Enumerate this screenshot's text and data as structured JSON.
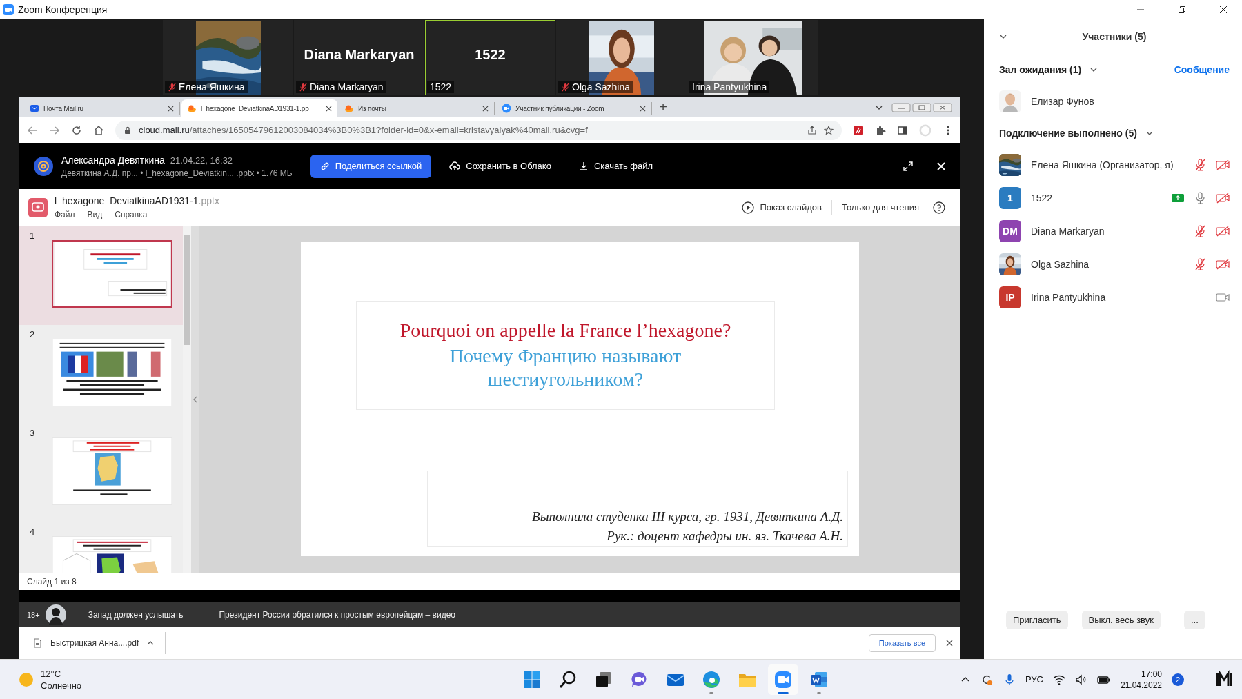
{
  "window": {
    "title": "Zoom Конференция"
  },
  "video_tiles": [
    {
      "name": "Елена Яшкина",
      "kind": "picture",
      "muted": true,
      "speaking": false
    },
    {
      "name": "Diana Markaryan",
      "kind": "name",
      "big_name": "Diana Markaryan",
      "muted": true,
      "speaking": false
    },
    {
      "name": "1522",
      "kind": "name",
      "big_name": "1522",
      "muted": false,
      "speaking": true
    },
    {
      "name": "Olga Sazhina",
      "kind": "picture",
      "muted": true,
      "speaking": false
    },
    {
      "name": "Irina Pantyukhina",
      "kind": "picture",
      "muted": false,
      "speaking": false
    }
  ],
  "browser": {
    "tabs": [
      {
        "title": "Почта Mail.ru",
        "kind": "mail",
        "selected": false
      },
      {
        "title": "l_hexagone_DeviatkinaAD1931-1.pp",
        "kind": "cloud",
        "selected": true
      },
      {
        "title": "Из почты",
        "kind": "cloud",
        "selected": false
      },
      {
        "title": "Участник публикации - Zoom",
        "kind": "zoom",
        "selected": false
      }
    ],
    "new_tab": "+",
    "address": {
      "host": "cloud.mail.ru",
      "path": "/attaches/16505479612003084034%3B0%3B1?folder-id=0&x-email=kristavyalyak%40mail.ru&cvg=f"
    },
    "cloud_header": {
      "sender": "Александра Девяткина",
      "date": "21.04.22, 16:32",
      "details": "Девяткина А.Д. пр... • l_hexagone_Deviatkin... .pptx • 1.76 МБ",
      "actions": [
        {
          "label": "Поделиться ссылкой",
          "kind": "primary"
        },
        {
          "label": "Сохранить в Облако",
          "kind": "plain"
        },
        {
          "label": "Скачать файл",
          "kind": "plain"
        }
      ]
    },
    "document": {
      "name": "l_hexagone_DeviatkinaAD1931-1",
      "ext": ".pptx",
      "menu": [
        "Файл",
        "Вид",
        "Справка"
      ],
      "slideshow": "Показ слайдов",
      "mode": "Только для чтения",
      "thumbnails": [
        {
          "number": "1",
          "kind": "title",
          "selected": true
        },
        {
          "number": "2",
          "kind": "flags",
          "selected": false
        },
        {
          "number": "3",
          "kind": "map",
          "selected": false
        },
        {
          "number": "4",
          "kind": "shapes",
          "selected": false
        }
      ],
      "slide": {
        "title_fr": "Pourquoi on appelle la France l’hexagone?",
        "title_ru": "Почему Францию называют шестиугольником?",
        "credits": [
          "Выполнила студенка III курса, гр. 1931, Девяткина А.Д.",
          "Рук.: доцент кафедры ин. яз. Ткачева А.Н."
        ]
      },
      "status": "Слайд 1 из 8"
    },
    "news": {
      "age": "18+",
      "items": [
        "Запад должен услышать",
        "Президент России обратился к простым европейцам – видео"
      ]
    },
    "downloads": {
      "file": "Быстрицкая Анна....pdf",
      "show_all": "Показать все"
    }
  },
  "participants_panel": {
    "title": "Участники (5)",
    "waiting": {
      "label": "Зал ожидания (1)",
      "action": "Сообщение",
      "people": [
        {
          "name": "Елизар Фунов"
        }
      ]
    },
    "connected": {
      "label": "Подключение выполнено (5)",
      "people": [
        {
          "name": "Елена Яшкина (Организатор, я)",
          "audio": true,
          "muted": true,
          "video": false,
          "sharing": false
        },
        {
          "name": "1522",
          "kind": "initials",
          "initials": "1",
          "color": "#2b7cc0",
          "audio": true,
          "muted": false,
          "video": false,
          "sharing": true
        },
        {
          "name": "Diana Markaryan",
          "kind": "initials",
          "initials": "DM",
          "color": "#8e44b0",
          "audio": true,
          "muted": true,
          "video": false,
          "sharing": false
        },
        {
          "name": "Olga Sazhina",
          "audio": true,
          "muted": true,
          "video": false,
          "sharing": false
        },
        {
          "name": "Irina Pantyukhina",
          "kind": "initials",
          "initials": "IP",
          "color": "#c8382e",
          "audio": false,
          "video": true,
          "sharing": false
        }
      ]
    },
    "buttons": [
      "Пригласить",
      "Выкл. весь звук",
      "..."
    ]
  },
  "taskbar": {
    "temperature": "12°C",
    "weather": "Солнечно",
    "apps": [
      {
        "kind": "start",
        "running": false,
        "active": false
      },
      {
        "kind": "search",
        "running": false,
        "active": false
      },
      {
        "kind": "taskview",
        "running": false,
        "active": false
      },
      {
        "kind": "chat",
        "running": false,
        "active": false
      },
      {
        "kind": "mail",
        "running": false,
        "active": false
      },
      {
        "kind": "edge",
        "running": true,
        "active": false
      },
      {
        "kind": "explorer",
        "running": false,
        "active": false
      },
      {
        "kind": "zoom",
        "running": true,
        "active": true
      },
      {
        "kind": "word",
        "running": true,
        "active": false
      }
    ],
    "language": "РУС",
    "time": "17:00",
    "date": "21.04.2022",
    "notifications": "2"
  }
}
